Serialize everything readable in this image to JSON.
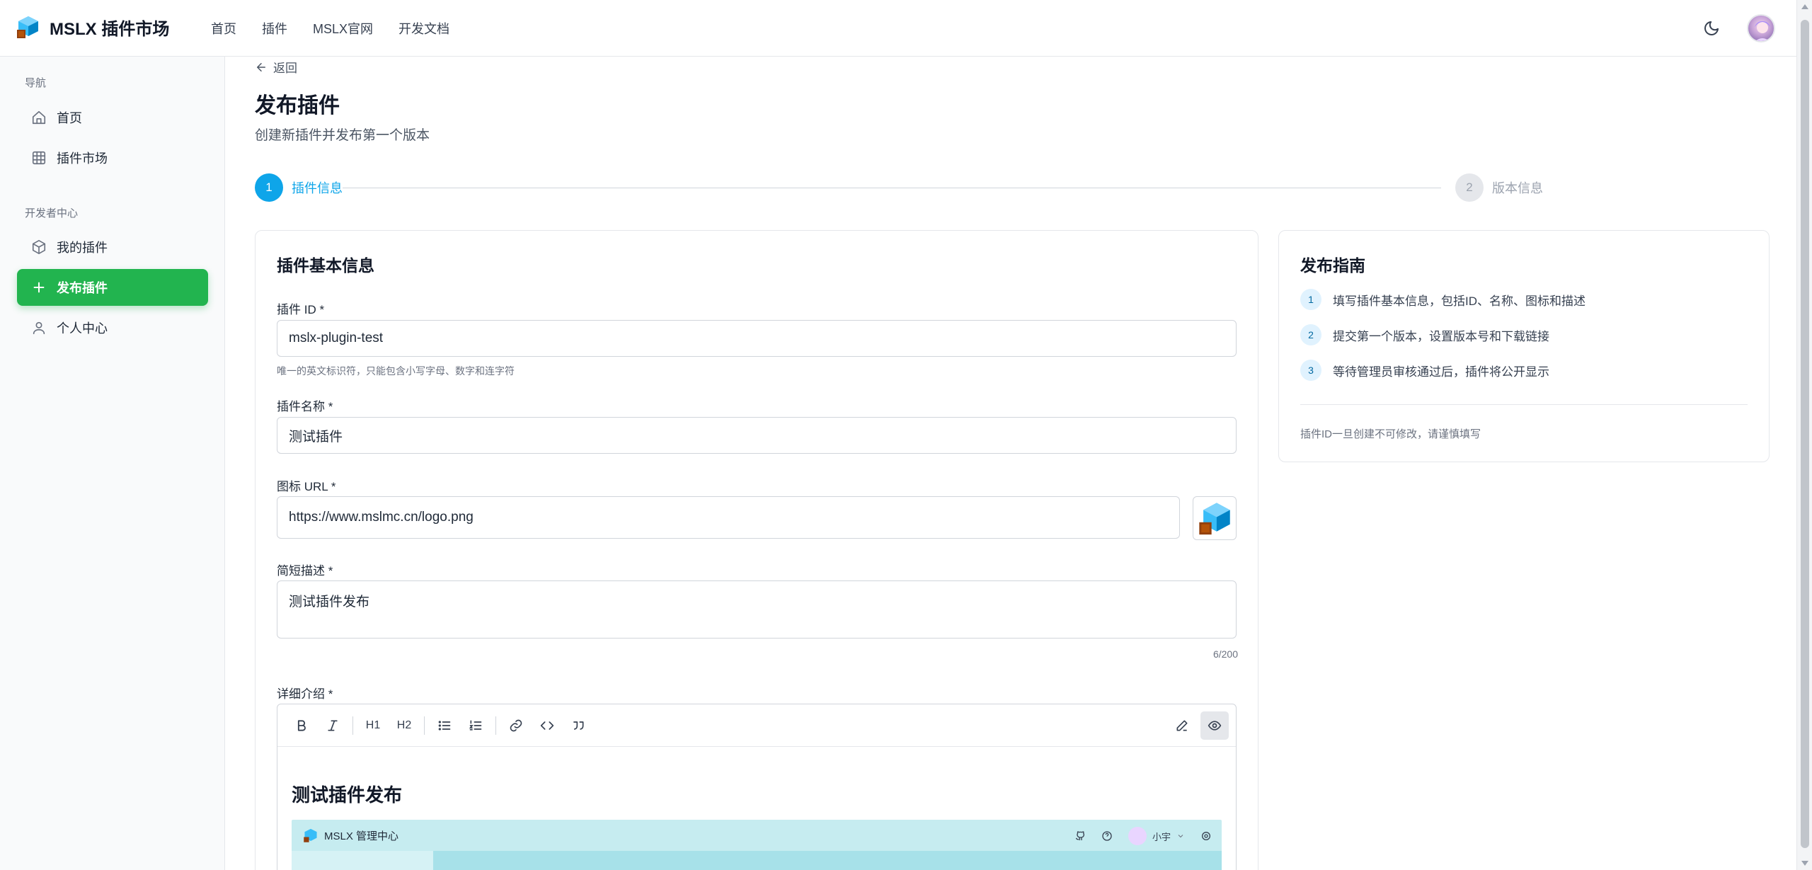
{
  "header": {
    "brand": "MSLX 插件市场",
    "nav": [
      "首页",
      "插件",
      "MSLX官网",
      "开发文档"
    ]
  },
  "sidebar": {
    "section_nav": "导航",
    "nav_items": [
      {
        "label": "首页",
        "icon": "home-icon"
      },
      {
        "label": "插件市场",
        "icon": "grid-icon"
      }
    ],
    "section_dev": "开发者中心",
    "dev_items": [
      {
        "label": "我的插件",
        "icon": "box-icon"
      },
      {
        "label": "发布插件",
        "icon": "plus-icon",
        "active": true
      },
      {
        "label": "个人中心",
        "icon": "user-icon"
      }
    ]
  },
  "page": {
    "back": "返回",
    "title": "发布插件",
    "subtitle": "创建新插件并发布第一个版本"
  },
  "steps": [
    {
      "num": "1",
      "label": "插件信息",
      "state": "active"
    },
    {
      "num": "2",
      "label": "版本信息",
      "state": "pending"
    }
  ],
  "form": {
    "title": "插件基本信息",
    "id_label": "插件 ID *",
    "id_value": "mslx-plugin-test",
    "id_hint": "唯一的英文标识符，只能包含小写字母、数字和连字符",
    "name_label": "插件名称 *",
    "name_value": "测试插件",
    "icon_label": "图标 URL *",
    "icon_value": "https://www.mslmc.cn/logo.png",
    "desc_label": "简短描述 *",
    "desc_value": "测试插件发布",
    "desc_count": "6/200",
    "detail_label": "详细介绍 *"
  },
  "editor": {
    "toolbar": [
      "bold-icon",
      "italic-icon",
      "heading1-icon",
      "heading2-icon",
      "bullet-list-icon",
      "ordered-list-icon",
      "link-icon",
      "code-icon",
      "quote-icon",
      "edit-icon",
      "preview-icon"
    ],
    "h1": "H1",
    "h2": "H2",
    "content_heading": "测试插件发布",
    "shot_title": "MSLX 管理中心",
    "shot_user": "小宇"
  },
  "guide": {
    "title": "发布指南",
    "items": [
      {
        "num": "1",
        "text": "填写插件基本信息，包括ID、名称、图标和描述"
      },
      {
        "num": "2",
        "text": "提交第一个版本，设置版本号和下载链接"
      },
      {
        "num": "3",
        "text": "等待管理员审核通过后，插件将公开显示"
      }
    ],
    "note": "插件ID一旦创建不可修改，请谨慎填写"
  },
  "colors": {
    "accent_blue": "#0ea5e9",
    "active_green": "#22b44f"
  }
}
